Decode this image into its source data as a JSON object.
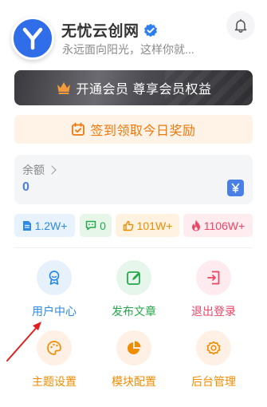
{
  "profile": {
    "name": "无忧云创网",
    "bio": "永远面向阳光，这样你就...",
    "avatar_letter": "Y"
  },
  "vip": {
    "label": "开通会员 尊享会员权益"
  },
  "checkin": {
    "label": "签到领取今日奖励"
  },
  "balance": {
    "label": "余额",
    "value": "0"
  },
  "stats": {
    "posts": "1.2W+",
    "comments": "0",
    "likes": "101W+",
    "fans": "1106W+"
  },
  "menu": [
    {
      "label": "用户中心",
      "icon": "user-center-icon",
      "color": "#2d8ae6"
    },
    {
      "label": "发布文章",
      "icon": "edit-icon",
      "color": "#25a84a"
    },
    {
      "label": "退出登录",
      "icon": "logout-icon",
      "color": "#ee4466"
    },
    {
      "label": "主题设置",
      "icon": "palette-icon",
      "color": "#f08c00"
    },
    {
      "label": "模块配置",
      "icon": "pie-chart-icon",
      "color": "#f08c00"
    },
    {
      "label": "后台管理",
      "icon": "gear-icon",
      "color": "#f08c00"
    }
  ],
  "colors": {
    "accent": "#4a80e6",
    "vip_icon": "#f39a3a",
    "checkin": "#f0780a"
  }
}
